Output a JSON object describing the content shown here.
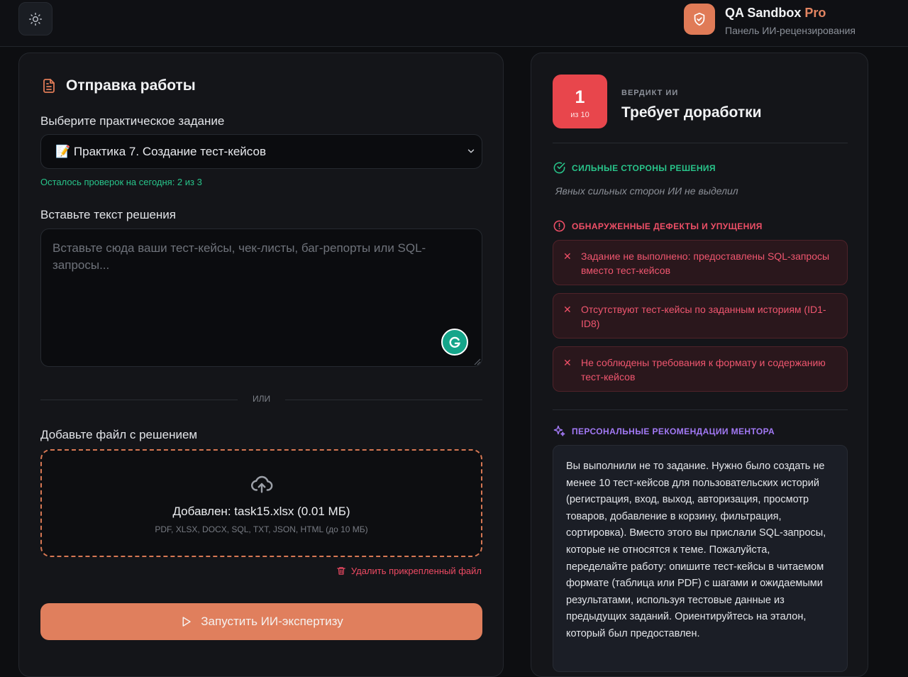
{
  "header": {
    "theme_toggle_icon": "sun-icon",
    "brand_title": "QA Sandbox",
    "brand_title_suffix": "Pro",
    "brand_subtitle": "Панель ИИ-рецензирования",
    "brand_logo_icon": "shield-check-icon"
  },
  "submission": {
    "title": "Отправка работы",
    "task_select_label": "Выберите практическое задание",
    "task_selected": "📝 Практика 7. Создание тест-кейсов",
    "checks_left": "Осталось проверок на сегодня: 2 из 3",
    "solution_label": "Вставьте текст решения",
    "solution_placeholder": "Вставьте сюда ваши тест-кейсы, чек-листы, баг-репорты или SQL-запросы...",
    "solution_value": "",
    "or_divider": "ИЛИ",
    "file_label": "Добавьте файл с решением",
    "file_added": "Добавлен: task15.xlsx (0.01 МБ)",
    "file_formats": "PDF, XLSX, DOCX, SQL, TXT, JSON, HTML (до 10 МБ)",
    "remove_file": "Удалить прикрепленный файл",
    "run_button": "Запустить ИИ-экспертизу"
  },
  "verdict": {
    "score": "1",
    "score_of": "из 10",
    "label": "ВЕРДИКТ ИИ",
    "value": "Требует доработки",
    "score_color": "#e8464c"
  },
  "strengths": {
    "title": "СИЛЬНЫЕ СТОРОНЫ РЕШЕНИЯ",
    "empty_text": "Явных сильных сторон ИИ не выделил",
    "color": "#28c48a"
  },
  "defects": {
    "title": "ОБНАРУЖЕННЫЕ ДЕФЕКТЫ И УПУЩЕНИЯ",
    "color": "#ef4f67",
    "items": [
      "Задание не выполнено: предоставлены SQL-запросы вместо тест-кейсов",
      "Отсутствуют тест-кейсы по заданным историям (ID1-ID8)",
      "Не соблюдены требования к формату и содержанию тест-кейсов"
    ]
  },
  "recommendations": {
    "title": "ПЕРСОНАЛЬНЫЕ РЕКОМЕНДАЦИИ МЕНТОРА",
    "color": "#a279f5",
    "text": "Вы выполнили не то задание. Нужно было создать не менее 10 тест-кейсов для пользовательских историй (регистрация, вход, выход, авторизация, просмотр товаров, добавление в корзину, фильтрация, сортировка). Вместо этого вы прислали SQL-запросы, которые не относятся к теме. Пожалуйста, переделайте работу: опишите тест-кейсы в читаемом формате (таблица или PDF) с шагами и ожидаемыми результатами, используя тестовые данные из предыдущих заданий. Ориентируйтесь на эталон, который был предоставлен."
  }
}
